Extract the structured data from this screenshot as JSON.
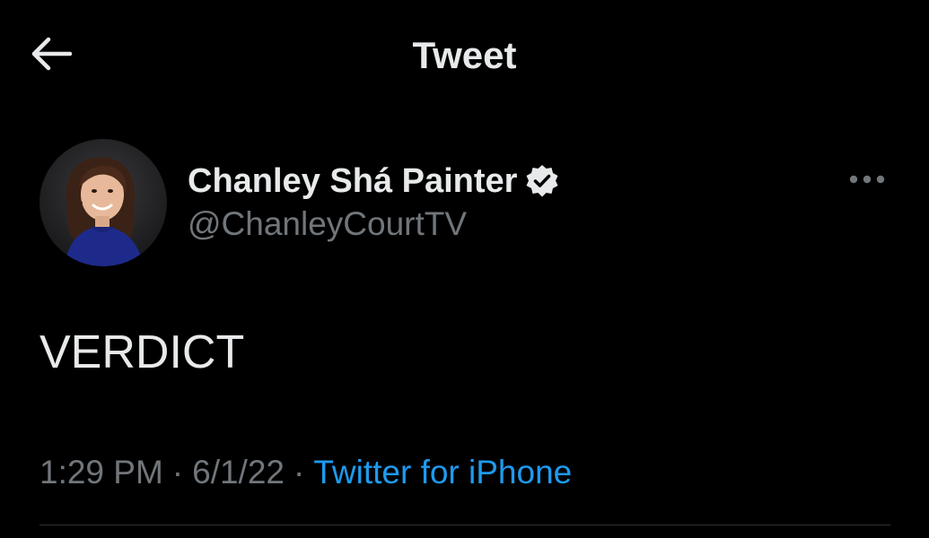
{
  "header": {
    "title": "Tweet",
    "back_icon": "arrow-left-icon"
  },
  "tweet": {
    "author": {
      "display_name": "Chanley Shá Painter",
      "handle": "@ChanleyCourtTV",
      "verified": true
    },
    "text": "VERDICT",
    "time": "1:29 PM",
    "date": "6/1/22",
    "separator": "·",
    "source": "Twitter for iPhone"
  },
  "colors": {
    "background": "#000000",
    "primary_text": "#e7e9ea",
    "secondary_text": "#71767b",
    "link": "#1d9bf0",
    "divider": "#2f3336"
  },
  "icons": {
    "verified": "verified-badge-icon",
    "more": "more-horizontal-icon"
  }
}
